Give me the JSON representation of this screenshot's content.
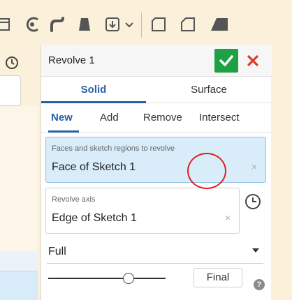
{
  "dialog": {
    "title": "Revolve 1",
    "ok_color": "#1fa045",
    "cancel_color": "#e03a2a",
    "body_tabs": [
      "Solid",
      "Surface"
    ],
    "active_body_tab": "Solid",
    "operations": [
      "New",
      "Add",
      "Remove",
      "Intersect"
    ],
    "active_operation": "New",
    "faces_field": {
      "label": "Faces and sketch regions to revolve",
      "value": "Face of Sketch 1",
      "clear": "×"
    },
    "axis_field": {
      "label": "Revolve axis",
      "value": "Edge of Sketch 1",
      "clear": "×"
    },
    "revolve_type": "Full",
    "final_label": "Final",
    "help": "?"
  },
  "toolbar": {
    "icons": [
      "sketch-face-icon",
      "fillet-icon",
      "sweep-icon",
      "loft-icon",
      "plane-icon",
      "chevron-down-icon",
      "shell-icon",
      "draft-icon",
      "chamfer-icon"
    ]
  },
  "colors": {
    "accent": "#2a5fa8",
    "selected_field": "#d8ecf9"
  }
}
